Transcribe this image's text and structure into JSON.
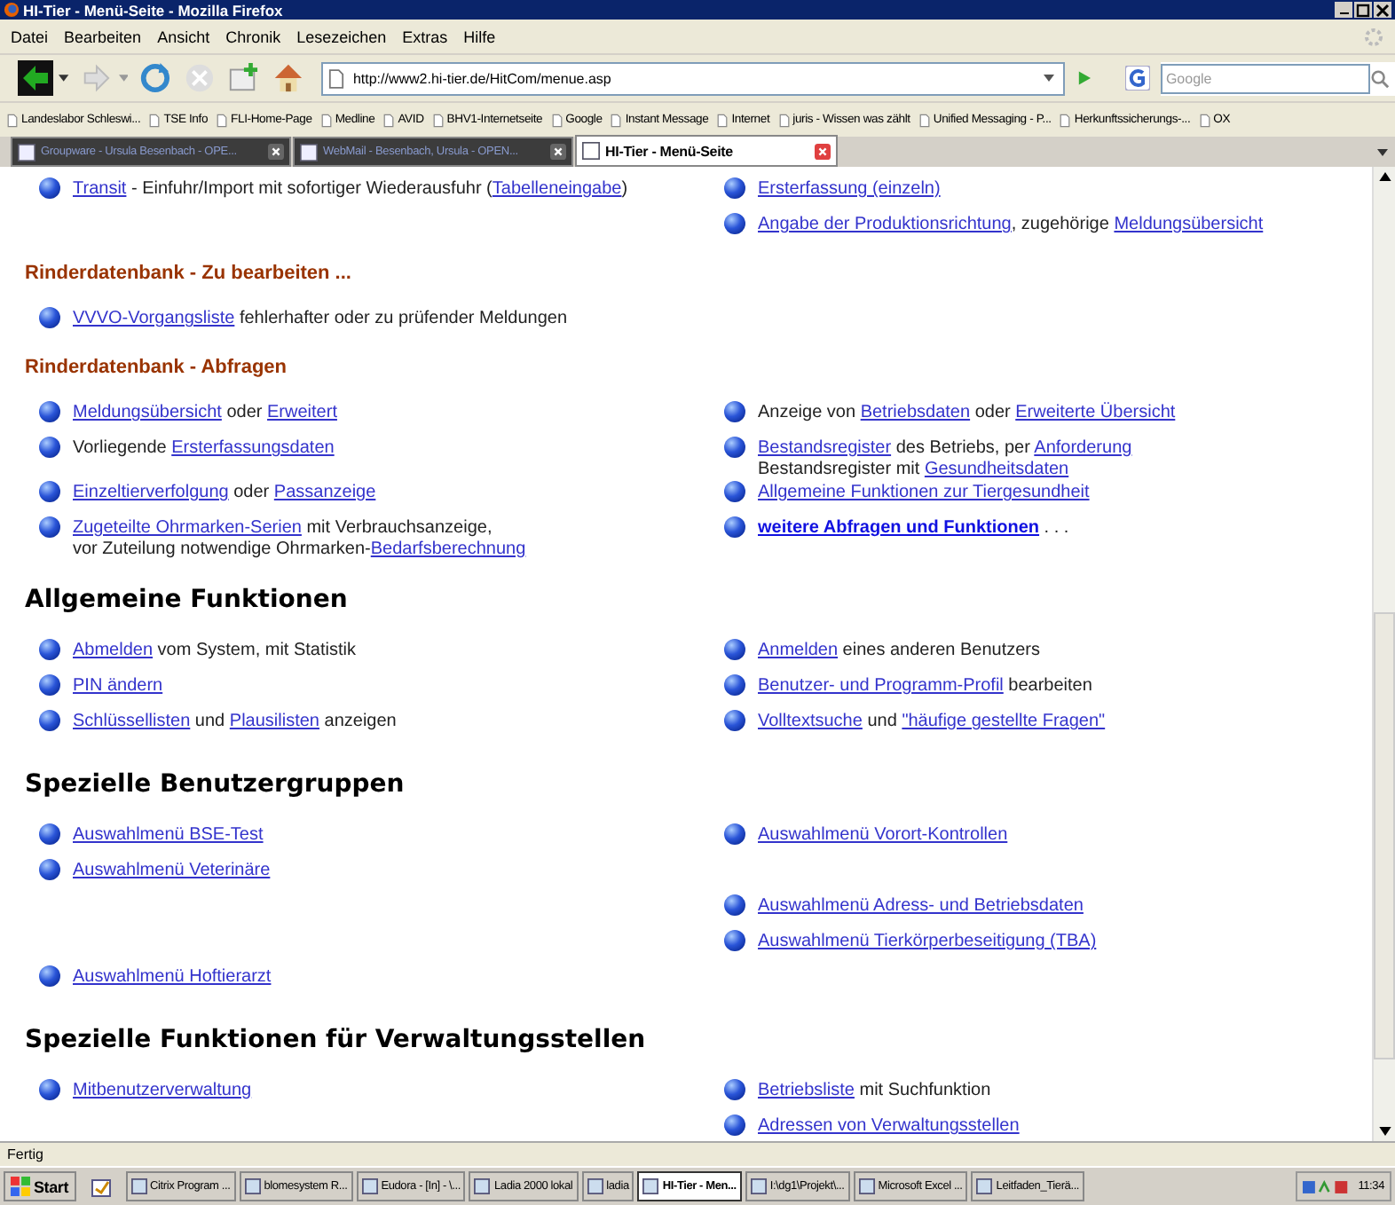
{
  "window": {
    "title": "HI-Tier - Menü-Seite - Mozilla Firefox"
  },
  "menu": [
    "Datei",
    "Bearbeiten",
    "Ansicht",
    "Chronik",
    "Lesezeichen",
    "Extras",
    "Hilfe"
  ],
  "address": {
    "value": "http://www2.hi-tier.de/HitCom/menue.asp"
  },
  "search": {
    "placeholder": "Google"
  },
  "bookmarks": [
    "Landeslabor Schleswi...",
    "TSE Info",
    "FLI-Home-Page",
    "Medline",
    "AVID",
    "BHV1-Internetseite",
    "Google",
    "Instant Message",
    "Internet",
    "juris - Wissen was zählt",
    "Unified Messaging - P...",
    "Herkunftssicherungs-...",
    "OX"
  ],
  "tabs": [
    {
      "label": "Groupware - Ursula Besenbach - OPE...",
      "selected": false
    },
    {
      "label": "WebMail - Besenbach, Ursula - OPEN...",
      "selected": false
    },
    {
      "label": "HI-Tier - Menü-Seite",
      "selected": true
    }
  ],
  "sections": [
    {
      "rows": [
        {
          "left": {
            "lines": [
              [
                {
                  "text": "Transit",
                  "link": true
                },
                {
                  "text": " - Einfuhr/Import mit sofortiger Wiederausfuhr (",
                  "link": false
                },
                {
                  "text": "Tabelleneingabe",
                  "link": true
                },
                {
                  "text": ")",
                  "link": false
                }
              ]
            ]
          },
          "right": {
            "lines": [
              [
                {
                  "text": "Ersterfassung (einzeln)",
                  "link": true
                }
              ]
            ]
          }
        },
        {
          "right": {
            "lines": [
              [
                {
                  "text": "Angabe der Produktionsrichtung",
                  "link": true
                },
                {
                  "text": ", zugehörige ",
                  "link": false
                },
                {
                  "text": "Meldungsübersicht",
                  "link": true
                }
              ]
            ]
          }
        }
      ]
    },
    {
      "heading": "Rinderdatenbank - Zu bearbeiten ...",
      "kind": "sub",
      "rows": [
        {
          "left": {
            "lines": [
              [
                {
                  "text": "VVVO-Vorgangsliste",
                  "link": true
                },
                {
                  "text": " fehlerhafter oder zu prüfender Meldungen",
                  "link": false
                }
              ]
            ]
          }
        }
      ]
    },
    {
      "heading": "Rinderdatenbank - Abfragen",
      "kind": "sub",
      "rows": [
        {
          "left": {
            "lines": [
              [
                {
                  "text": "Meldungsübersicht",
                  "link": true
                },
                {
                  "text": " oder ",
                  "link": false
                },
                {
                  "text": "Erweitert",
                  "link": true
                }
              ]
            ]
          },
          "right": {
            "lines": [
              [
                {
                  "text": "Anzeige von ",
                  "link": false
                },
                {
                  "text": "Betriebsdaten",
                  "link": true
                },
                {
                  "text": " oder ",
                  "link": false
                },
                {
                  "text": "Erweiterte Übersicht",
                  "link": true
                }
              ]
            ]
          }
        },
        {
          "left": {
            "lines": [
              [
                {
                  "text": "Vorliegende ",
                  "link": false
                },
                {
                  "text": "Ersterfassungsdaten",
                  "link": true
                }
              ]
            ]
          },
          "right": {
            "lines": [
              [
                {
                  "text": "Bestandsregister",
                  "link": true
                },
                {
                  "text": " des Betriebs, per ",
                  "link": false
                },
                {
                  "text": "Anforderung",
                  "link": true
                }
              ],
              [
                {
                  "text": "Bestandsregister mit ",
                  "link": false
                },
                {
                  "text": "Gesundheitsdaten",
                  "link": true
                }
              ]
            ]
          }
        },
        {
          "left": {
            "lines": [
              [
                {
                  "text": "Einzeltierverfolgung",
                  "link": true
                },
                {
                  "text": " oder ",
                  "link": false
                },
                {
                  "text": "Passanzeige",
                  "link": true
                }
              ]
            ]
          },
          "right": {
            "lines": [
              [
                {
                  "text": "Allgemeine Funktionen zur Tiergesundheit",
                  "link": true
                }
              ]
            ]
          }
        },
        {
          "left": {
            "lines": [
              [
                {
                  "text": "Zugeteilte Ohrmarken-Serien",
                  "link": true
                },
                {
                  "text": " mit Verbrauchsanzeige,",
                  "link": false
                }
              ],
              [
                {
                  "text": "vor Zuteilung notwendige Ohrmarken-",
                  "link": false
                },
                {
                  "text": "Bedarfsberechnung",
                  "link": true
                }
              ]
            ]
          },
          "right": {
            "lines": [
              [
                {
                  "text": "weitere Abfragen und Funktionen",
                  "link": true,
                  "bold": true
                },
                {
                  "text": " . . .",
                  "link": false
                }
              ]
            ]
          }
        }
      ]
    },
    {
      "heading": "Allgemeine Funktionen",
      "kind": "main",
      "rows": [
        {
          "left": {
            "lines": [
              [
                {
                  "text": "Abmelden",
                  "link": true
                },
                {
                  "text": " vom System, mit Statistik",
                  "link": false
                }
              ]
            ]
          },
          "right": {
            "lines": [
              [
                {
                  "text": "Anmelden",
                  "link": true
                },
                {
                  "text": " eines anderen Benutzers",
                  "link": false
                }
              ]
            ]
          }
        },
        {
          "left": {
            "lines": [
              [
                {
                  "text": "PIN ändern",
                  "link": true
                }
              ]
            ]
          },
          "right": {
            "lines": [
              [
                {
                  "text": "Benutzer- und Programm-Profil",
                  "link": true
                },
                {
                  "text": " bearbeiten",
                  "link": false
                }
              ]
            ]
          }
        },
        {
          "left": {
            "lines": [
              [
                {
                  "text": "Schlüssellisten",
                  "link": true
                },
                {
                  "text": " und ",
                  "link": false
                },
                {
                  "text": "Plausilisten",
                  "link": true
                },
                {
                  "text": " anzeigen",
                  "link": false
                }
              ]
            ]
          },
          "right": {
            "lines": [
              [
                {
                  "text": "Volltextsuche",
                  "link": true
                },
                {
                  "text": " und ",
                  "link": false
                },
                {
                  "text": "\"häufige gestellte Fragen\"",
                  "link": true
                }
              ]
            ]
          }
        }
      ]
    },
    {
      "heading": "Spezielle Benutzergruppen",
      "kind": "main",
      "rows": [
        {
          "left": {
            "lines": [
              [
                {
                  "text": "Auswahlmenü BSE-Test",
                  "link": true
                }
              ]
            ]
          },
          "right": {
            "lines": [
              [
                {
                  "text": "Auswahlmenü Vorort-Kontrollen",
                  "link": true
                }
              ]
            ]
          }
        },
        {
          "left": {
            "lines": [
              [
                {
                  "text": "Auswahlmenü Veterinäre",
                  "link": true
                }
              ]
            ]
          }
        },
        {
          "right": {
            "lines": [
              [
                {
                  "text": "Auswahlmenü Adress- und Betriebsdaten",
                  "link": true
                }
              ]
            ]
          }
        },
        {
          "right": {
            "lines": [
              [
                {
                  "text": "Auswahlmenü Tierkörperbeseitigung (TBA)",
                  "link": true
                }
              ]
            ]
          }
        },
        {
          "left": {
            "lines": [
              [
                {
                  "text": "Auswahlmenü Hoftierarzt",
                  "link": true
                }
              ]
            ]
          }
        }
      ]
    },
    {
      "heading": "Spezielle Funktionen für Verwaltungsstellen",
      "kind": "main",
      "rows": [
        {
          "left": {
            "lines": [
              [
                {
                  "text": "Mitbenutzerverwaltung",
                  "link": true
                }
              ]
            ]
          },
          "right": {
            "lines": [
              [
                {
                  "text": "Betriebsliste",
                  "link": true
                },
                {
                  "text": " mit Suchfunktion",
                  "link": false
                }
              ]
            ]
          }
        },
        {
          "right": {
            "lines": [
              [
                {
                  "text": "Adressen von Verwaltungsstellen",
                  "link": true
                }
              ]
            ]
          }
        }
      ]
    }
  ],
  "status_bar": "Fertig",
  "taskbar": {
    "start": "Start",
    "items": [
      {
        "label": "Citrix Program ...",
        "selected": false
      },
      {
        "label": "blomesystem R...",
        "selected": false
      },
      {
        "label": "Eudora - [In] - \\...",
        "selected": false
      },
      {
        "label": "Ladia 2000 lokal",
        "selected": false
      },
      {
        "label": "ladia",
        "selected": false
      },
      {
        "label": "HI-Tier - Men...",
        "selected": true
      },
      {
        "label": "I:\\dg1\\Projekt\\...",
        "selected": false
      },
      {
        "label": "Microsoft Excel ...",
        "selected": false
      },
      {
        "label": "Leitfaden_Tierä...",
        "selected": false
      }
    ],
    "clock": "11:34"
  }
}
